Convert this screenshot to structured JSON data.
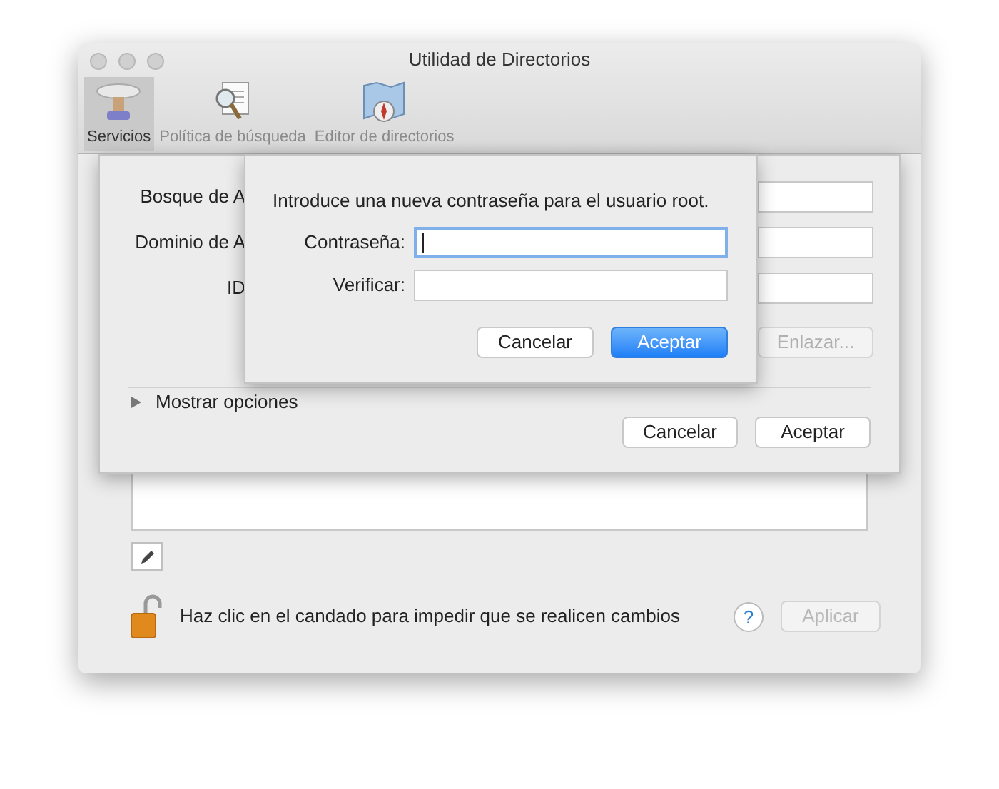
{
  "window": {
    "title": "Utilidad de Directorios"
  },
  "toolbar": {
    "tabs": [
      {
        "label": "Servicios",
        "kind": "services",
        "selected": true
      },
      {
        "label": "Política de búsqueda",
        "kind": "search",
        "selected": false
      },
      {
        "label": "Editor de directorios",
        "kind": "editor",
        "selected": false
      }
    ]
  },
  "bind_sheet": {
    "fields": [
      {
        "label": "Bosque de A"
      },
      {
        "label": "Dominio de A"
      },
      {
        "label": "ID"
      }
    ],
    "bind_button": {
      "label": "Enlazar...",
      "disabled": true
    },
    "disclosure": {
      "label": "Mostrar opciones",
      "expanded": false
    },
    "buttons": [
      {
        "label": "Cancelar",
        "default": false
      },
      {
        "label": "Aceptar",
        "default": false
      }
    ]
  },
  "password_sheet": {
    "message": "Introduce una nueva contraseña para el usuario root.",
    "fields": [
      {
        "label": "Contraseña:",
        "focused": true
      },
      {
        "label": "Verificar:",
        "focused": false
      }
    ],
    "buttons": [
      {
        "label": "Cancelar",
        "default": false
      },
      {
        "label": "Aceptar",
        "default": true
      }
    ]
  },
  "footer": {
    "locked": false,
    "lock_text": "Haz clic en el candado para impedir que se realicen cambios",
    "help": "?",
    "apply": {
      "label": "Aplicar",
      "disabled": true
    }
  }
}
